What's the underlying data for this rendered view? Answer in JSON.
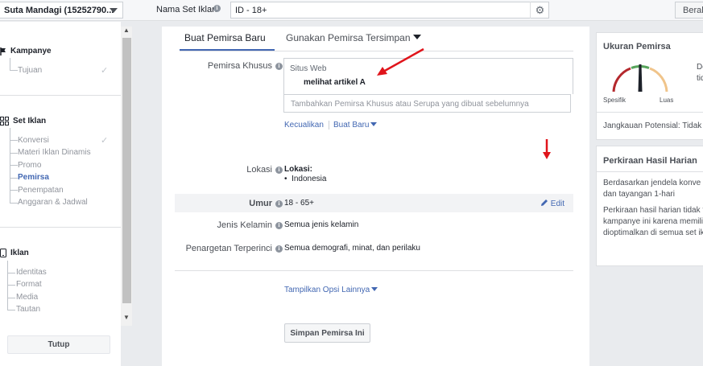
{
  "topbar": {
    "account": "Suta Mandagi (15252790...",
    "set_name_label": "Nama Set Iklan",
    "set_name_value": "ID - 18+",
    "right_button": "Beral"
  },
  "sidebar": {
    "campaign": {
      "title": "Kampanye",
      "items": [
        "Tujuan"
      ]
    },
    "adset": {
      "title": "Set Iklan",
      "items": [
        "Konversi",
        "Materi Iklan Dinamis",
        "Promo",
        "Pemirsa",
        "Penempatan",
        "Anggaran & Jadwal"
      ]
    },
    "ad": {
      "title": "Iklan",
      "items": [
        "Identitas",
        "Format",
        "Media",
        "Tautan"
      ]
    },
    "close": "Tutup"
  },
  "main": {
    "tabs": [
      "Buat Pemirsa Baru",
      "Gunakan Pemirsa Tersimpan"
    ],
    "custom": {
      "label": "Pemirsa Khusus",
      "source": "Situs Web",
      "audience": "melihat artikel A",
      "placeholder": "Tambahkan Pemirsa Khusus atau Serupa yang dibuat sebelumnya",
      "exclude": "Kecualikan",
      "create_new": "Buat Baru"
    },
    "location": {
      "label": "Lokasi",
      "heading": "Lokasi:",
      "item": "Indonesia"
    },
    "age": {
      "label": "Umur",
      "value": "18 - 65+",
      "edit": "Edit"
    },
    "gender": {
      "label": "Jenis Kelamin",
      "value": "Semua jenis kelamin"
    },
    "targeting": {
      "label": "Penargetan Terperinci",
      "value": "Semua demografi, minat, dan perilaku"
    },
    "more_options": "Tampilkan Opsi Lainnya",
    "save_button": "Simpan Pemirsa Ini"
  },
  "right": {
    "size": {
      "title": "Ukuran Pemirsa",
      "left_label": "Spesifik",
      "right_label": "Luas",
      "side_1": "De",
      "side_2": "tid",
      "potential": "Jangkauan Potensial: Tidak te"
    },
    "daily": {
      "title": "Perkiraan Hasil Harian",
      "p1_l1": "Berdasarkan jendela konve",
      "p1_l2": "dan tayangan 1-hari",
      "p2_l1": "Perkiraan hasil harian tidak te",
      "p2_l2": "kampanye ini karena memiliki",
      "p2_l3": "dioptimalkan di semua set ikla"
    }
  },
  "colors": {
    "accent": "#4267b2",
    "annotation": "#e0141b"
  }
}
